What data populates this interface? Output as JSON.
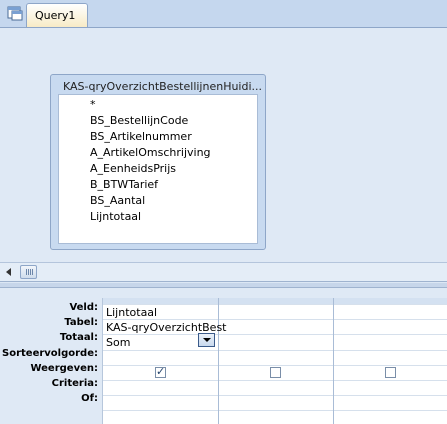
{
  "tab": {
    "title": "Query1",
    "icon": "query-icon"
  },
  "field_list": {
    "title": "KAS-qryOverzichtBestellijnenHuidi...",
    "fields": [
      "*",
      "BS_BestellijnCode",
      "BS_Artikelnummer",
      "A_ArtikelOmschrijving",
      "A_EenheidsPrijs",
      "B_BTWTarief",
      "BS_Aantal",
      "Lijntotaal"
    ]
  },
  "grid": {
    "row_labels": {
      "veld": "Veld:",
      "tabel": "Tabel:",
      "totaal": "Totaal:",
      "sorteervolgorde": "Sorteervolgorde:",
      "weergeven": "Weergeven:",
      "criteria": "Criteria:",
      "of": "Of:"
    },
    "columns": [
      {
        "veld": "Lijntotaal",
        "tabel": "KAS-qryOverzichtBest",
        "totaal": "Som",
        "weergeven": true
      },
      {
        "veld": "",
        "tabel": "",
        "totaal": "",
        "weergeven": false
      },
      {
        "veld": "",
        "tabel": "",
        "totaal": "",
        "weergeven": false
      }
    ]
  },
  "colors": {
    "accent": "#c5d7ee",
    "tab_active": "#f7ebc6",
    "pane": "#dfe9f5"
  }
}
